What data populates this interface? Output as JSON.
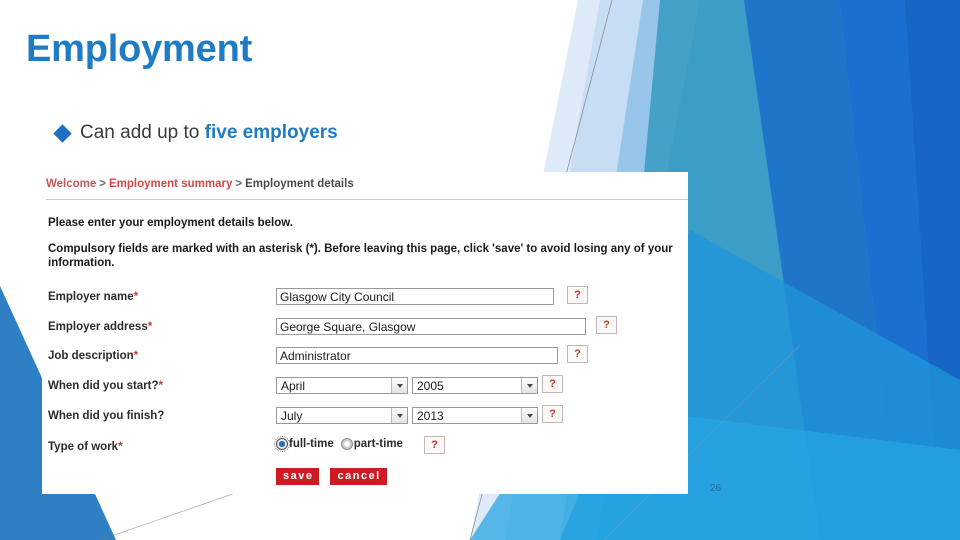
{
  "slide": {
    "title": "Employment",
    "page_number": "26",
    "title_color": "#1F7BC4",
    "accent_color": "#1F6FC0"
  },
  "bullet": {
    "icon": "diamond-bullet-icon",
    "text_plain": "Can add up to ",
    "text_highlight": "five employers"
  },
  "form": {
    "breadcrumb": {
      "items": [
        "Welcome",
        "Employment summary",
        "Employment details"
      ],
      "separator": ">"
    },
    "intro_line_1": "Please enter your employment details below.",
    "intro_line_2": "Compulsory fields are marked with an asterisk (*). Before leaving this page, click 'save' to avoid losing any of your information.",
    "fields": [
      {
        "label": "Employer name",
        "required_mark": "*",
        "type": "text",
        "value": "Glasgow City Council",
        "help": "?"
      },
      {
        "label": "Employer address",
        "required_mark": "*",
        "type": "text",
        "value": "George Square, Glasgow",
        "help": "?"
      },
      {
        "label": "Job description",
        "required_mark": "*",
        "type": "text",
        "value": "Administrator",
        "help": "?"
      },
      {
        "label": "When did you start?",
        "required_mark": "*",
        "type": "date-select",
        "month": "April",
        "year": "2005",
        "help": "?"
      },
      {
        "label": "When did you finish?",
        "required_mark": "",
        "type": "date-select",
        "month": "July",
        "year": "2013",
        "help": "?"
      },
      {
        "label": "Type of work",
        "required_mark": "*",
        "type": "radio",
        "options": [
          "full-time",
          "part-time"
        ],
        "selected": "full-time",
        "help": "?"
      }
    ],
    "buttons": {
      "save": "save",
      "cancel": "cancel",
      "color": "#CC1B23"
    }
  }
}
